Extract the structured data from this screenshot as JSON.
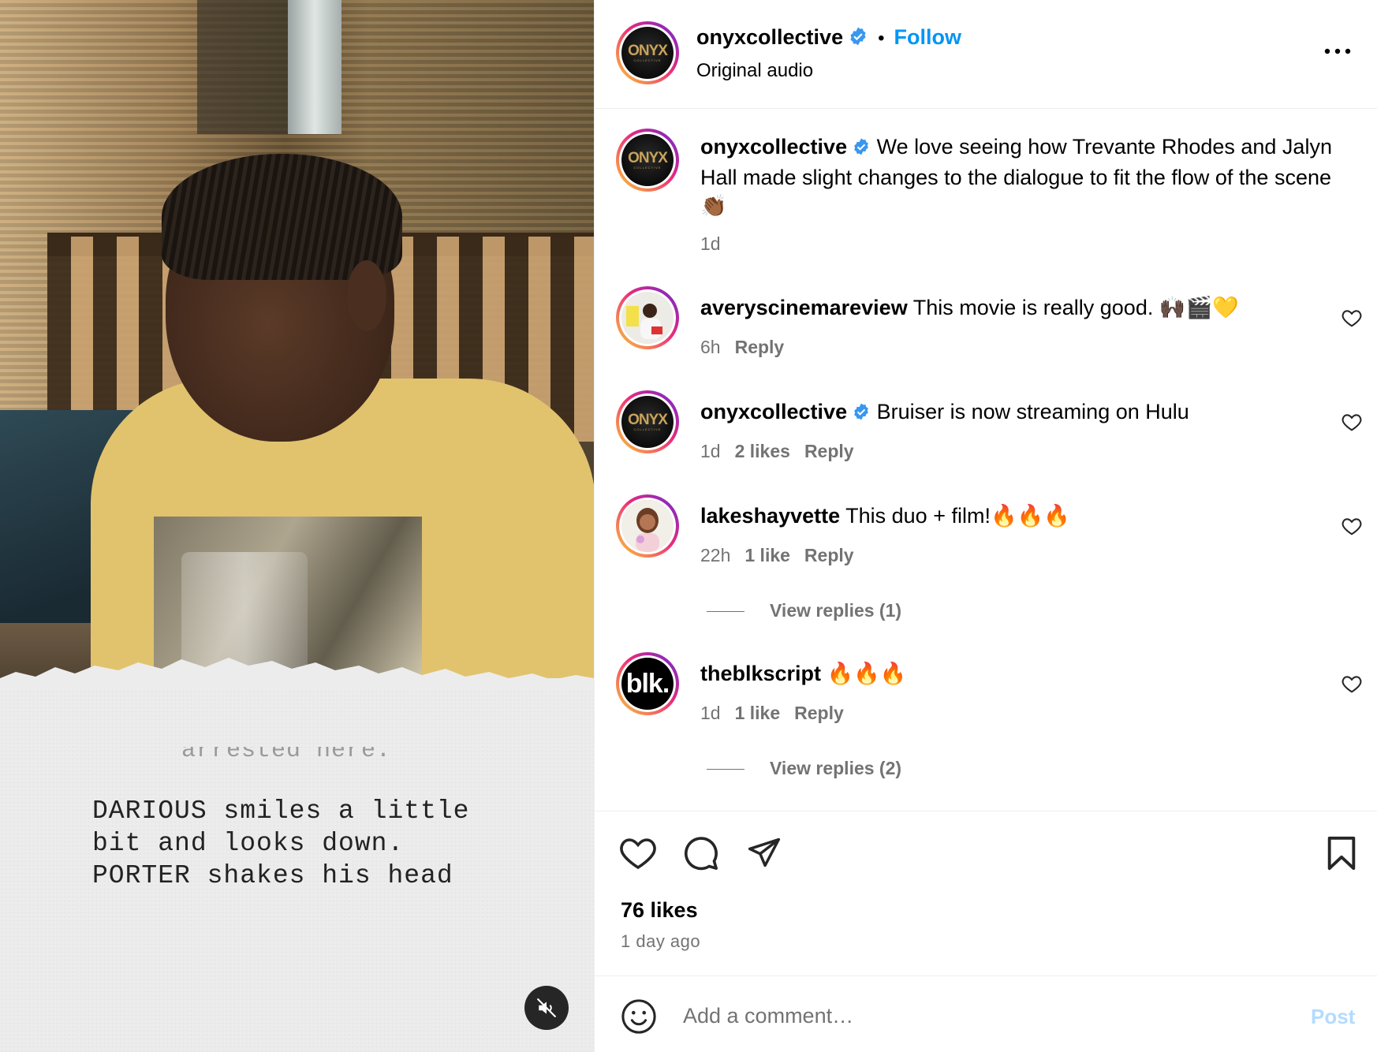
{
  "media": {
    "script_partial": "arrested here.",
    "script_text": "DARIOUS smiles a little\nbit and looks down.\nPORTER shakes his head",
    "mute_icon": "speaker-muted-icon"
  },
  "header": {
    "username": "onyxcollective",
    "avatar_text": "ONYX",
    "avatar_subtext": "COLLECTIVE",
    "separator": "•",
    "follow_label": "Follow",
    "audio_label": "Original audio"
  },
  "caption": {
    "username": "onyxcollective",
    "text": "We love seeing how Trevante Rhodes and Jalyn Hall made slight changes to the dialogue to fit the flow of the scene 👏🏾",
    "age": "1d"
  },
  "comments": [
    {
      "username": "averyscinemareview",
      "text": "This movie is really good. 🙌🏿🎬💛",
      "age": "6h",
      "likes": "",
      "reply": "Reply",
      "verified": false,
      "view_replies": ""
    },
    {
      "username": "onyxcollective",
      "text": "Bruiser is now streaming on Hulu",
      "age": "1d",
      "likes": "2 likes",
      "reply": "Reply",
      "verified": true,
      "view_replies": ""
    },
    {
      "username": "lakeshayvette",
      "text": "This duo + film!🔥🔥🔥",
      "age": "22h",
      "likes": "1 like",
      "reply": "Reply",
      "verified": false,
      "view_replies": "View replies (1)"
    },
    {
      "username": "theblkscript",
      "text": "🔥🔥🔥",
      "age": "1d",
      "likes": "1 like",
      "reply": "Reply",
      "verified": false,
      "view_replies": "View replies (2)",
      "avatar_text": "blk."
    }
  ],
  "actions": {
    "likes": "76 likes",
    "age": "1 day ago"
  },
  "add_comment": {
    "placeholder": "Add a comment…",
    "post_label": "Post"
  },
  "colors": {
    "accent": "#0095f6",
    "muted_text": "#737373",
    "post_disabled": "#b3dbff",
    "verified": "#3897f0"
  }
}
